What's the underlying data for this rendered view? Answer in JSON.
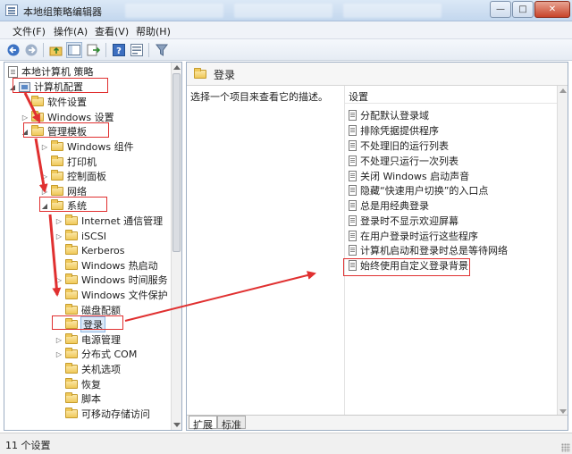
{
  "window": {
    "title": "本地组策略编辑器",
    "minimize_glyph": "—",
    "maximize_glyph": "□",
    "close_glyph": "✕"
  },
  "menu": [
    "文件(F)",
    "操作(A)",
    "查看(V)",
    "帮助(H)"
  ],
  "toolbar_icons": [
    "back-arrow-icon",
    "forward-arrow-icon",
    "up-folder-icon",
    "show-hide-tree-icon",
    "export-list-icon",
    "help-icon",
    "properties-icon",
    "filter-icon"
  ],
  "tree": {
    "root": "本地计算机 策略",
    "computer_config": "计算机配置",
    "software_settings": "软件设置",
    "windows_settings": "Windows 设置",
    "admin_templates": "管理模板",
    "windows_components": "Windows 组件",
    "printers": "打印机",
    "control_panel": "控制面板",
    "network": "网络",
    "system": "系统",
    "system_children": [
      "Internet 通信管理",
      "iSCSI",
      "Kerberos",
      "Windows 热启动",
      "Windows 时间服务",
      "Windows 文件保护",
      "磁盘配额",
      "登录",
      "电源管理",
      "分布式 COM",
      "关机选项",
      "恢复",
      "脚本",
      "可移动存储访问"
    ]
  },
  "right": {
    "title": "登录",
    "description": "选择一个项目来查看它的描述。",
    "column_header": "设置",
    "settings": [
      "分配默认登录域",
      "排除凭据提供程序",
      "不处理旧的运行列表",
      "不处理只运行一次列表",
      "关闭 Windows 启动声音",
      "隐藏“快速用户切换”的入口点",
      "总是用经典登录",
      "登录时不显示欢迎屏幕",
      "在用户登录时运行这些程序",
      "计算机启动和登录时总是等待网络",
      "始终使用自定义登录背景"
    ],
    "tabs": [
      "扩展",
      "标准"
    ]
  },
  "status": "11 个设置",
  "colors": {
    "annotation": "#e03030",
    "selection": "#dbe9f8"
  }
}
